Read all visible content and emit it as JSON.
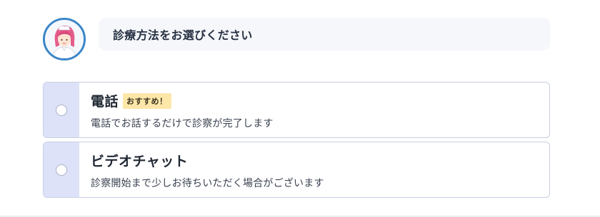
{
  "avatar": {
    "icon": "nurse-avatar-icon"
  },
  "prompt": {
    "text": "診療方法をお選びください"
  },
  "options": [
    {
      "title": "電話",
      "badge": "おすすめ！",
      "description": "電話でお話するだけで診察が完了します",
      "selected": false
    },
    {
      "title": "ビデオチャット",
      "description": "診察開始まで少しお待ちいただく場合がございます",
      "selected": false
    }
  ],
  "colors": {
    "radio_column": "#dde2f8",
    "badge_background": "#fde7a8",
    "avatar_ring": "#3a86c8",
    "bubble_background": "#f6f7fb"
  }
}
